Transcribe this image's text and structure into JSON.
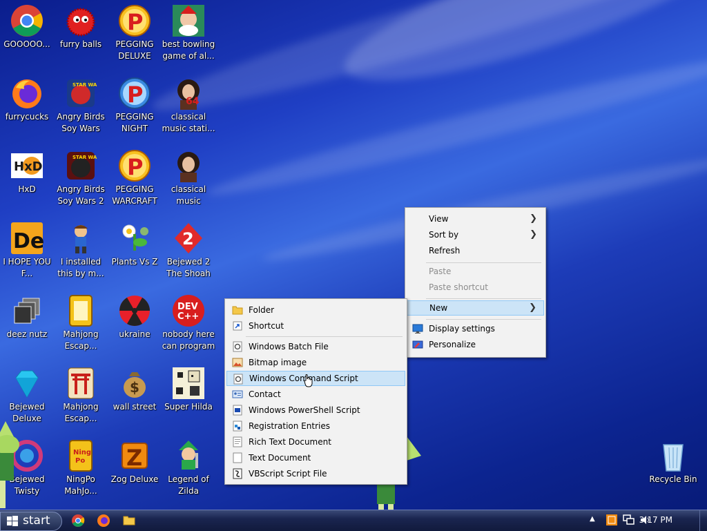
{
  "desktop_icons": [
    {
      "label": "GOOOOO...",
      "icon": "chrome-icon"
    },
    {
      "label": "furry balls",
      "icon": "red-fuzzball-icon"
    },
    {
      "label": "PEGGING DELUXE",
      "icon": "pegging-p-icon"
    },
    {
      "label": "best bowling game of al...",
      "icon": "bowling-santa-icon"
    },
    {
      "label": "furrycucks",
      "icon": "firefox-icon"
    },
    {
      "label": "Angry Birds Soy Wars",
      "icon": "angry-birds-starwars-icon"
    },
    {
      "label": "PEGGING NIGHT",
      "icon": "pegging-p-icon"
    },
    {
      "label": "classical music stati...",
      "icon": "classical-portrait-icon"
    },
    {
      "label": "HxD",
      "icon": "hxd-icon"
    },
    {
      "label": "Angry Birds Soy Wars 2",
      "icon": "angry-birds-starwars2-icon"
    },
    {
      "label": "PEGGING WARCRAFT",
      "icon": "pegging-p-icon"
    },
    {
      "label": "classical music station",
      "icon": "classical-portrait-icon"
    },
    {
      "label": "I HOPE YOU F...",
      "icon": "de-icon"
    },
    {
      "label": "I installed this by m...",
      "icon": "cartoon-kid-icon"
    },
    {
      "label": "Plants Vs Z",
      "icon": "plants-vs-zombies-icon"
    },
    {
      "label": "Bejewed 2 The Shoah",
      "icon": "bejeweled2-icon"
    },
    {
      "label": "deez nutz",
      "icon": "stacked-windows-icon"
    },
    {
      "label": "Mahjong Escap...",
      "icon": "mahjong-tile-icon"
    },
    {
      "label": "ukraine",
      "icon": "radiation-icon"
    },
    {
      "label": "nobody here can program",
      "icon": "devcpp-icon"
    },
    {
      "label": "Bejewed Deluxe",
      "icon": "diamond-icon"
    },
    {
      "label": "Mahjong Escap...",
      "icon": "torii-gate-icon"
    },
    {
      "label": "wall street",
      "icon": "money-bag-icon"
    },
    {
      "label": "Super Hilda",
      "icon": "pixel-character-icon"
    },
    {
      "label": "Bejewed Twisty",
      "icon": "bejeweled-twist-icon"
    },
    {
      "label": "NingPo MahJo...",
      "icon": "ningpo-tile-icon"
    },
    {
      "label": "Zog Deluxe",
      "icon": "zog-icon"
    },
    {
      "label": "Legend of Zilda",
      "icon": "link-character-icon"
    }
  ],
  "recycle_bin": {
    "label": "Recycle Bin",
    "icon": "recycle-bin-icon"
  },
  "context_menu": {
    "items": [
      {
        "label": "View",
        "submenu": true,
        "disabled": false
      },
      {
        "label": "Sort by",
        "submenu": true,
        "disabled": false
      },
      {
        "label": "Refresh",
        "submenu": false,
        "disabled": false
      },
      {
        "label": "Paste",
        "submenu": false,
        "disabled": true
      },
      {
        "label": "Paste shortcut",
        "submenu": false,
        "disabled": true
      },
      {
        "label": "New",
        "submenu": true,
        "disabled": false,
        "highlighted": true
      },
      {
        "label": "Display settings",
        "icon": "monitor-icon"
      },
      {
        "label": "Personalize",
        "icon": "personalize-icon"
      }
    ]
  },
  "new_submenu": {
    "items": [
      {
        "label": "Folder",
        "icon": "folder-icon"
      },
      {
        "label": "Shortcut",
        "icon": "shortcut-icon"
      },
      {
        "label": "Windows Batch File",
        "icon": "gear-file-icon"
      },
      {
        "label": "Bitmap image",
        "icon": "bitmap-icon"
      },
      {
        "label": "Windows Command Script",
        "icon": "gear-file-icon",
        "highlighted": true
      },
      {
        "label": "Contact",
        "icon": "contact-card-icon"
      },
      {
        "label": "Windows PowerShell Script",
        "icon": "powershell-file-icon"
      },
      {
        "label": "Registration Entries",
        "icon": "registry-icon"
      },
      {
        "label": "Rich Text Document",
        "icon": "document-icon"
      },
      {
        "label": "Text Document",
        "icon": "text-file-icon"
      },
      {
        "label": "VBScript Script File",
        "icon": "vbscript-icon"
      }
    ]
  },
  "taskbar": {
    "start_label": "start",
    "pinned": [
      "chrome-icon",
      "firefox-icon",
      "file-explorer-icon"
    ],
    "tray": [
      "show-hidden-icons-icon",
      "flag-icon",
      "network-icon",
      "volume-icon"
    ],
    "clock": "3:17 PM"
  }
}
